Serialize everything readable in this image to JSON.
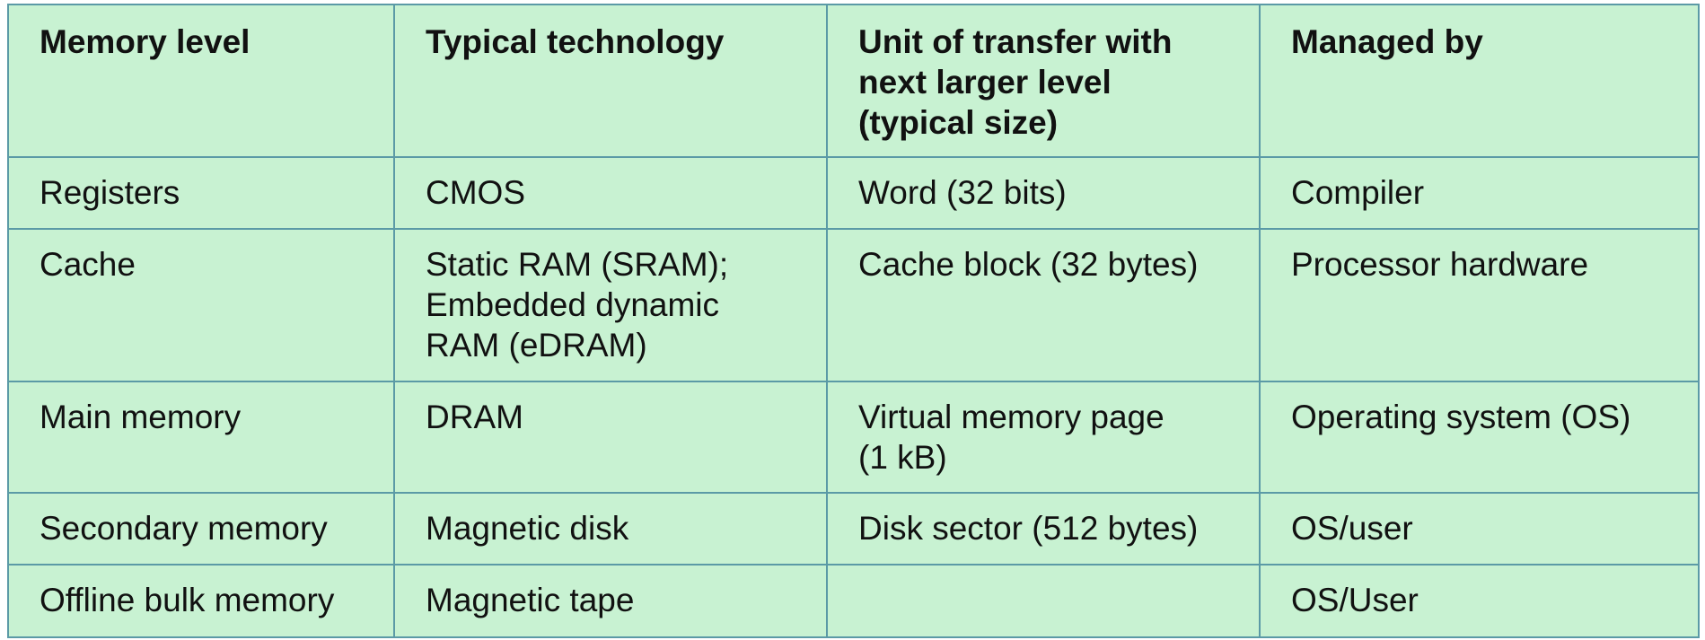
{
  "table": {
    "headers": [
      "Memory level",
      "Typical technology",
      "Unit of transfer with\nnext larger level\n(typical size)",
      "Managed by"
    ],
    "rows": [
      [
        "Registers",
        "CMOS",
        "Word (32 bits)",
        "Compiler"
      ],
      [
        "Cache",
        "Static RAM (SRAM);\nEmbedded dynamic\nRAM (eDRAM)",
        "Cache block (32 bytes)",
        "Processor hardware"
      ],
      [
        "Main memory",
        "DRAM",
        "Virtual memory page\n(1 kB)",
        "Operating system (OS)"
      ],
      [
        "Secondary memory",
        "Magnetic disk",
        "Disk sector (512 bytes)",
        "OS/user"
      ],
      [
        "Offline bulk memory",
        "Magnetic tape",
        "",
        "OS/User"
      ]
    ]
  },
  "colors": {
    "cell_background": "#c8f2d2",
    "border": "#5b9aa6",
    "text": "#111111"
  }
}
